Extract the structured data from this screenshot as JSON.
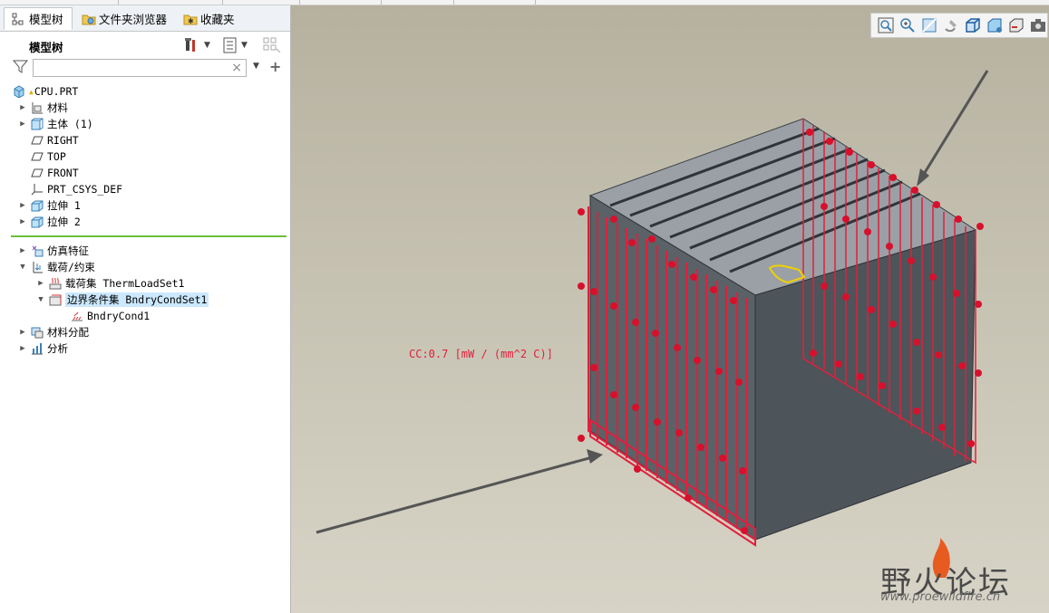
{
  "tabs": [
    {
      "label": "模型树",
      "icon": "model-tree-icon"
    },
    {
      "label": "文件夹浏览器",
      "icon": "folder-browser-icon"
    },
    {
      "label": "收藏夹",
      "icon": "favorites-icon"
    }
  ],
  "panel": {
    "title": "模型树",
    "search": {
      "value": "",
      "placeholder": ""
    }
  },
  "tree": {
    "root": "CPU.PRT",
    "items": [
      {
        "label": "材料",
        "icon": "material-icon"
      },
      {
        "label": "主体 (1)",
        "icon": "body-icon"
      },
      {
        "label": "RIGHT",
        "icon": "datum-plane-icon"
      },
      {
        "label": "TOP",
        "icon": "datum-plane-icon"
      },
      {
        "label": "FRONT",
        "icon": "datum-plane-icon"
      },
      {
        "label": "PRT_CSYS_DEF",
        "icon": "csys-icon"
      },
      {
        "label": "拉伸 1",
        "icon": "extrude-icon"
      },
      {
        "label": "拉伸 2",
        "icon": "extrude-icon"
      }
    ],
    "sim_items": [
      {
        "label": "仿真特征",
        "icon": "sim-feature-icon"
      },
      {
        "label": "载荷/约束",
        "icon": "loads-constraints-icon"
      },
      {
        "label": "载荷集 ThermLoadSet1",
        "icon": "load-set-icon"
      },
      {
        "label": "边界条件集 BndryCondSet1",
        "icon": "bc-set-icon"
      },
      {
        "label": "BndryCond1",
        "icon": "bc-icon"
      },
      {
        "label": "材料分配",
        "icon": "material-assign-icon"
      },
      {
        "label": "分析",
        "icon": "analysis-icon"
      }
    ]
  },
  "viewport": {
    "annotation": "CC:0.7 [mW / (mm^2 C)]",
    "toolbar_icons": [
      "zoom-fit-icon",
      "zoom-in-icon",
      "zoom-box-icon",
      "repaint-icon",
      "display-style-icon",
      "saved-views-icon",
      "view-manager-icon",
      "camera-icon"
    ],
    "colors": {
      "bc_marker": "#e0203c",
      "part": "#4b5157",
      "background_top": "#b6b19f",
      "background_bottom": "#d7d3c6"
    }
  },
  "watermark": {
    "main": "野火论坛",
    "sub": "www.proewildfire.cn"
  }
}
